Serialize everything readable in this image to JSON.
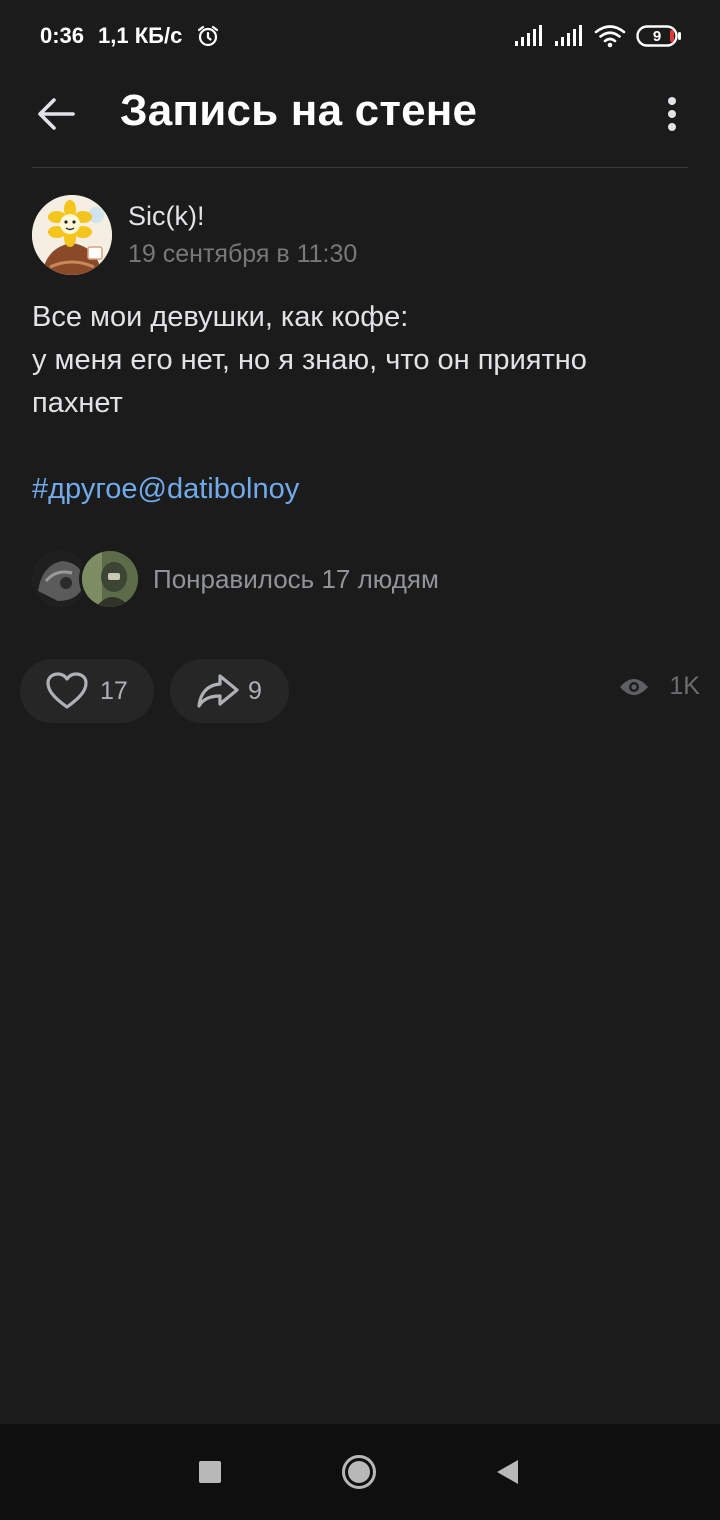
{
  "status_bar": {
    "time": "0:36",
    "net_speed": "1,1 КБ/с",
    "battery": "9",
    "icons": [
      "alarm-icon",
      "signal-icon",
      "signal-icon",
      "wifi-icon",
      "battery-icon"
    ]
  },
  "app_bar": {
    "title": "Запись на стене",
    "back_icon": "arrow-left-icon",
    "menu_icon": "more-vertical-icon"
  },
  "post": {
    "author": "Sic(k)!",
    "date": "19 сентября в 11:30",
    "text_lines": [
      "Все мои девушки, как кофе:",
      "у меня его нет, но я знаю, что он приятно",
      "пахнет"
    ],
    "hashtag": "#другое@datibolnoy",
    "likes_text": "Понравилось 17 людям"
  },
  "actions": {
    "likes": "17",
    "shares": "9",
    "views": "1K",
    "like_icon": "heart-icon",
    "share_icon": "share-arrow-icon",
    "views_icon": "eye-icon"
  },
  "colors": {
    "background": "#1b1b1b",
    "link": "#71aaeb",
    "secondary_text": "#909499"
  }
}
